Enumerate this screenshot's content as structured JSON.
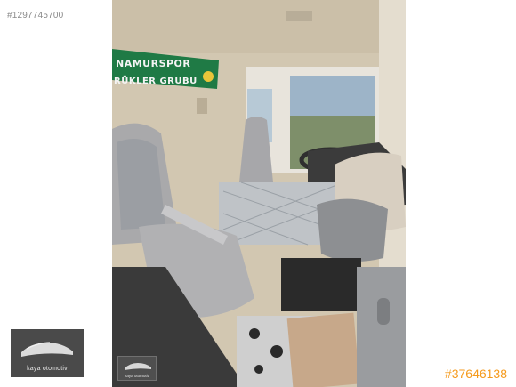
{
  "listing_id": "#1297745700",
  "photo": {
    "banner_line1": "NAMURSPOR",
    "banner_line2": "RÜKLER GRUBU"
  },
  "watermark_logo": {
    "text": "kaya otomotiv"
  },
  "watermark_logo_small": {
    "text": "kaya otomotiv"
  },
  "ad_code": "#37646138",
  "colors": {
    "ad_code": "#f59a1c",
    "banner": "#1f7a45",
    "seat_fabric": "#a9a9ab",
    "cabin_wall": "#d6cbb6"
  }
}
